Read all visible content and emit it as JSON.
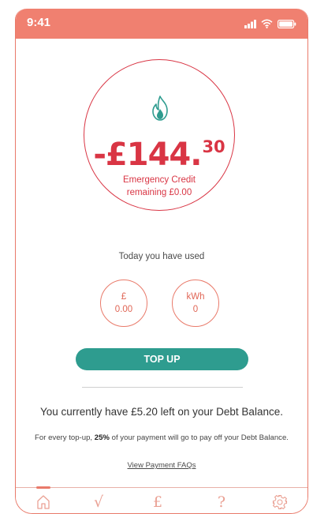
{
  "status_bar": {
    "time": "9:41"
  },
  "balance": {
    "amount_main": "-£144.",
    "amount_cents": "30",
    "emergency_line1": "Emergency Credit",
    "emergency_line2": "remaining £0.00"
  },
  "usage": {
    "heading": "Today you have used",
    "cost_unit": "£",
    "cost_value": "0.00",
    "energy_unit": "kWh",
    "energy_value": "0"
  },
  "top_up_label": "TOP UP",
  "debt": {
    "message": "You currently have £5.20 left on your Debt Balance.",
    "share_prefix": "For every top-up,",
    "share_percent": "25%",
    "share_suffix": "of your payment will go to pay off your Debt Balance.",
    "faq_link": "View Payment FAQs"
  },
  "tabs": {
    "usage_glyph": "√",
    "payments_glyph": "£",
    "help_glyph": "?"
  },
  "colors": {
    "status_bar": "#f08070",
    "debt_red": "#d93544",
    "accent_coral": "#e97a6a",
    "button_teal": "#2e9c8f",
    "flame_teal": "#2e9c8f"
  },
  "icons": [
    "signal-icon",
    "wifi-icon",
    "battery-icon",
    "flame-icon",
    "home-icon",
    "usage-icon",
    "payments-icon",
    "help-icon",
    "settings-icon"
  ]
}
